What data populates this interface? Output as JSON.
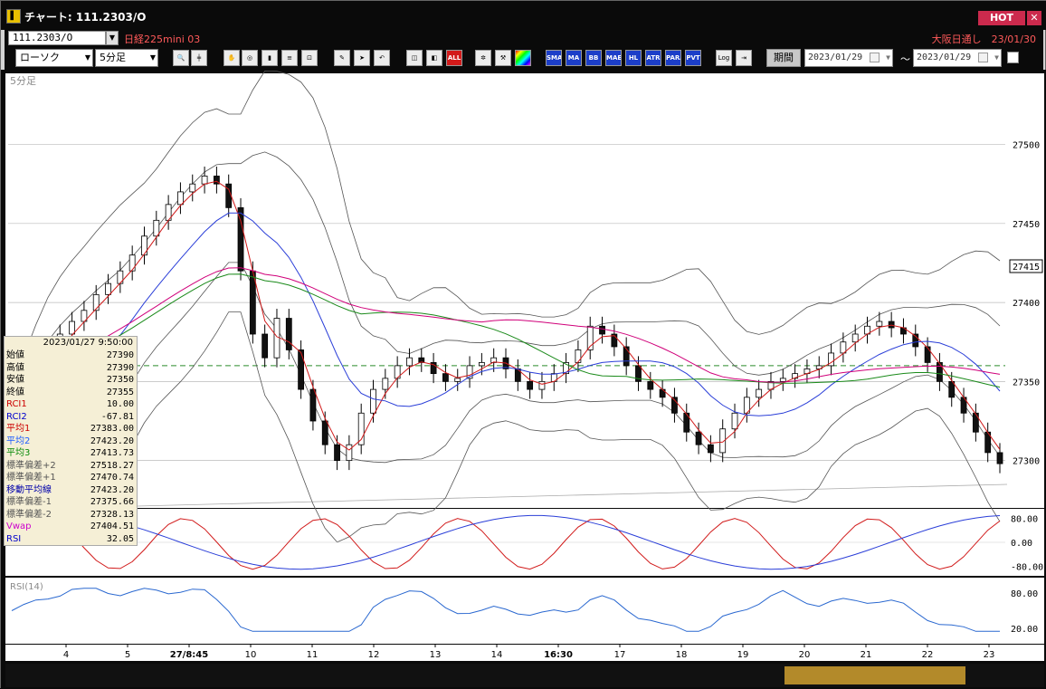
{
  "window": {
    "title": "チャート: 111.2303/O",
    "hot_label": "HOT",
    "close_glyph": "✕"
  },
  "symbol": {
    "code": "111.2303/O",
    "name": "日経225mini 03",
    "session": "大阪日通し　23/01/30"
  },
  "toolbar": {
    "chart_type": "ローソク",
    "interval": "5分足",
    "period_label": "期間",
    "date_from": "2023/01/29",
    "date_to": "2023/01/29",
    "range_sep": "～",
    "indicator_buttons": [
      "SMA",
      "MA",
      "BB",
      "MAE",
      "HL",
      "ATR",
      "PARA",
      "PVT",
      "Log"
    ]
  },
  "chart_data": {
    "type": "candlestick",
    "interval_label": "5分足",
    "y_ticks": [
      27500,
      27450,
      27400,
      27350,
      27300
    ],
    "current_price": 27415,
    "x_labels": [
      "4",
      "5",
      "27/8:45",
      "10",
      "11",
      "12",
      "13",
      "14",
      "16:30",
      "17",
      "18",
      "19",
      "20",
      "21",
      "22",
      "23"
    ],
    "close_series_approx": [
      27330,
      27338,
      27355,
      27370,
      27380,
      27388,
      27395,
      27405,
      27412,
      27420,
      27430,
      27442,
      27452,
      27462,
      27470,
      27475,
      27480,
      27475,
      27460,
      27420,
      27380,
      27365,
      27390,
      27370,
      27345,
      27325,
      27310,
      27300,
      27310,
      27330,
      27345,
      27352,
      27360,
      27365,
      27362,
      27355,
      27350,
      27352,
      27360,
      27362,
      27365,
      27358,
      27350,
      27345,
      27350,
      27355,
      27362,
      27370,
      27385,
      27380,
      27372,
      27360,
      27350,
      27345,
      27340,
      27330,
      27318,
      27310,
      27305,
      27320,
      27330,
      27340,
      27345,
      27350,
      27352,
      27355,
      27358,
      27360,
      27368,
      27375,
      27380,
      27385,
      27388,
      27384,
      27380,
      27372,
      27362,
      27350,
      27340,
      27330,
      27318,
      27305,
      27298
    ],
    "info_panel": {
      "datetime": "2023/01/27 9:50:00",
      "rows": [
        {
          "label": "始値",
          "value": "27390",
          "color": "#000000"
        },
        {
          "label": "高値",
          "value": "27390",
          "color": "#000000"
        },
        {
          "label": "安値",
          "value": "27350",
          "color": "#000000"
        },
        {
          "label": "終値",
          "value": "27355",
          "color": "#000000"
        },
        {
          "label": "RCI1",
          "value": "10.00",
          "color": "#cc0000"
        },
        {
          "label": "RCI2",
          "value": "-67.81",
          "color": "#0000cc"
        },
        {
          "label": "平均1",
          "value": "27383.00",
          "color": "#cc0000"
        },
        {
          "label": "平均2",
          "value": "27423.20",
          "color": "#1e5cff"
        },
        {
          "label": "平均3",
          "value": "27413.73",
          "color": "#0a8a0a"
        },
        {
          "label": "標準偏差+2",
          "value": "27518.27",
          "color": "#555555"
        },
        {
          "label": "標準偏差+1",
          "value": "27470.74",
          "color": "#555555"
        },
        {
          "label": "移動平均線",
          "value": "27423.20",
          "color": "#0000aa"
        },
        {
          "label": "標準偏差-1",
          "value": "27375.66",
          "color": "#555555"
        },
        {
          "label": "標準偏差-2",
          "value": "27328.13",
          "color": "#555555"
        },
        {
          "label": "Vwap",
          "value": "27404.51",
          "color": "#cc00cc"
        },
        {
          "label": "RSI",
          "value": "32.05",
          "color": "#0000cc"
        }
      ]
    },
    "rci_panel": {
      "ticks": [
        "80.00",
        "0.00",
        "-80.00"
      ]
    },
    "rsi_panel": {
      "title": "RSI(14)",
      "ticks": [
        "80.00",
        "20.00"
      ]
    }
  },
  "colors": {
    "bg": "#ffffff",
    "frame": "#0a0a0a",
    "ma1": "#d11a1a",
    "ma2": "#2a3ed8",
    "ma3": "#1a8a1a",
    "vwap": "#d0007a",
    "band": "#555555",
    "rsi": "#2a68d0"
  }
}
